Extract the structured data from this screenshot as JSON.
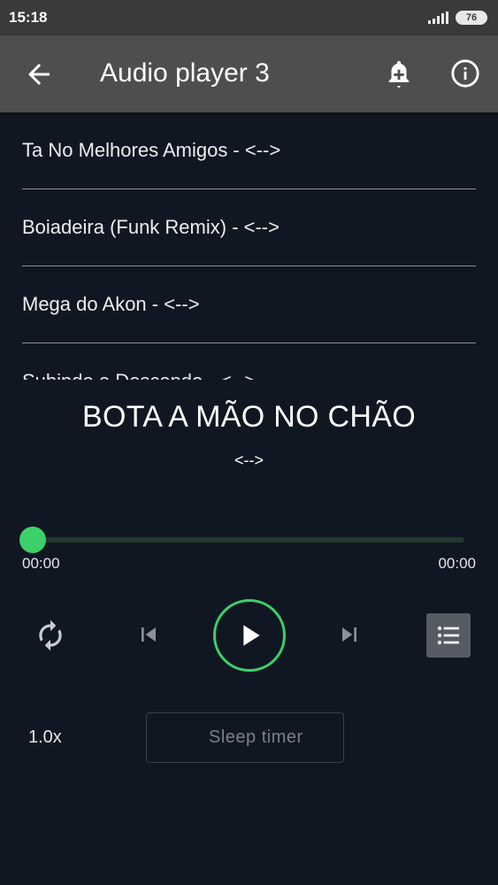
{
  "status_bar": {
    "time": "15:18",
    "battery": "76"
  },
  "app_bar": {
    "title": "Audio player 3",
    "back_icon": "arrow-left-icon",
    "bell_icon": "bell-plus-icon",
    "info_icon": "info-circle-icon"
  },
  "playlist": {
    "items": [
      {
        "label": "Ta No Melhores Amigos - <-->"
      },
      {
        "label": "Boiadeira (Funk Remix) - <-->"
      },
      {
        "label": "Mega do Akon - <-->"
      },
      {
        "label": "Subindo e Descendo - <-->"
      }
    ]
  },
  "now_playing": {
    "title": "BOTA A MÃO NO CHÃO",
    "artist": "<-->",
    "progress": 0,
    "time_current": "00:00",
    "time_total": "00:00"
  },
  "controls": {
    "repeat_icon": "repeat-icon",
    "previous_icon": "skip-previous-icon",
    "play_icon": "play-icon",
    "next_icon": "skip-next-icon",
    "playlist_icon": "list-icon"
  },
  "footer": {
    "speed": "1.0x",
    "sleep_timer": "Sleep timer",
    "moon_icon": "moon-icon"
  },
  "colors": {
    "accent": "#3cd06a",
    "background": "#111722",
    "app_bar": "#4e4e4c"
  }
}
